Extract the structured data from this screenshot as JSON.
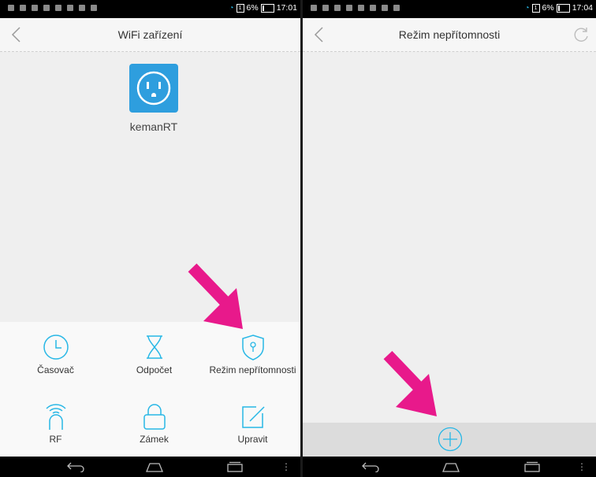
{
  "left_screen": {
    "status": {
      "battery": "6%",
      "time": "17:01"
    },
    "title": "WiFi zařízení",
    "device": {
      "name": "kemanRT",
      "icon": "smart-plug-icon"
    },
    "features": [
      {
        "label": "Časovač",
        "icon": "clock-icon"
      },
      {
        "label": "Odpočet",
        "icon": "hourglass-icon"
      },
      {
        "label": "Režim nepřítomnosti",
        "icon": "shield-icon"
      },
      {
        "label": "RF",
        "icon": "rf-signal-icon"
      },
      {
        "label": "Zámek",
        "icon": "lock-icon"
      },
      {
        "label": "Upravit",
        "icon": "edit-icon"
      }
    ]
  },
  "right_screen": {
    "status": {
      "battery": "6%",
      "time": "17:04"
    },
    "title": "Režim nepřítomnosti",
    "add_button": {
      "icon": "plus-circle-icon"
    }
  },
  "colors": {
    "accent": "#2e9ede",
    "icon_blue": "#27b7e6",
    "arrow": "#e8198b"
  }
}
